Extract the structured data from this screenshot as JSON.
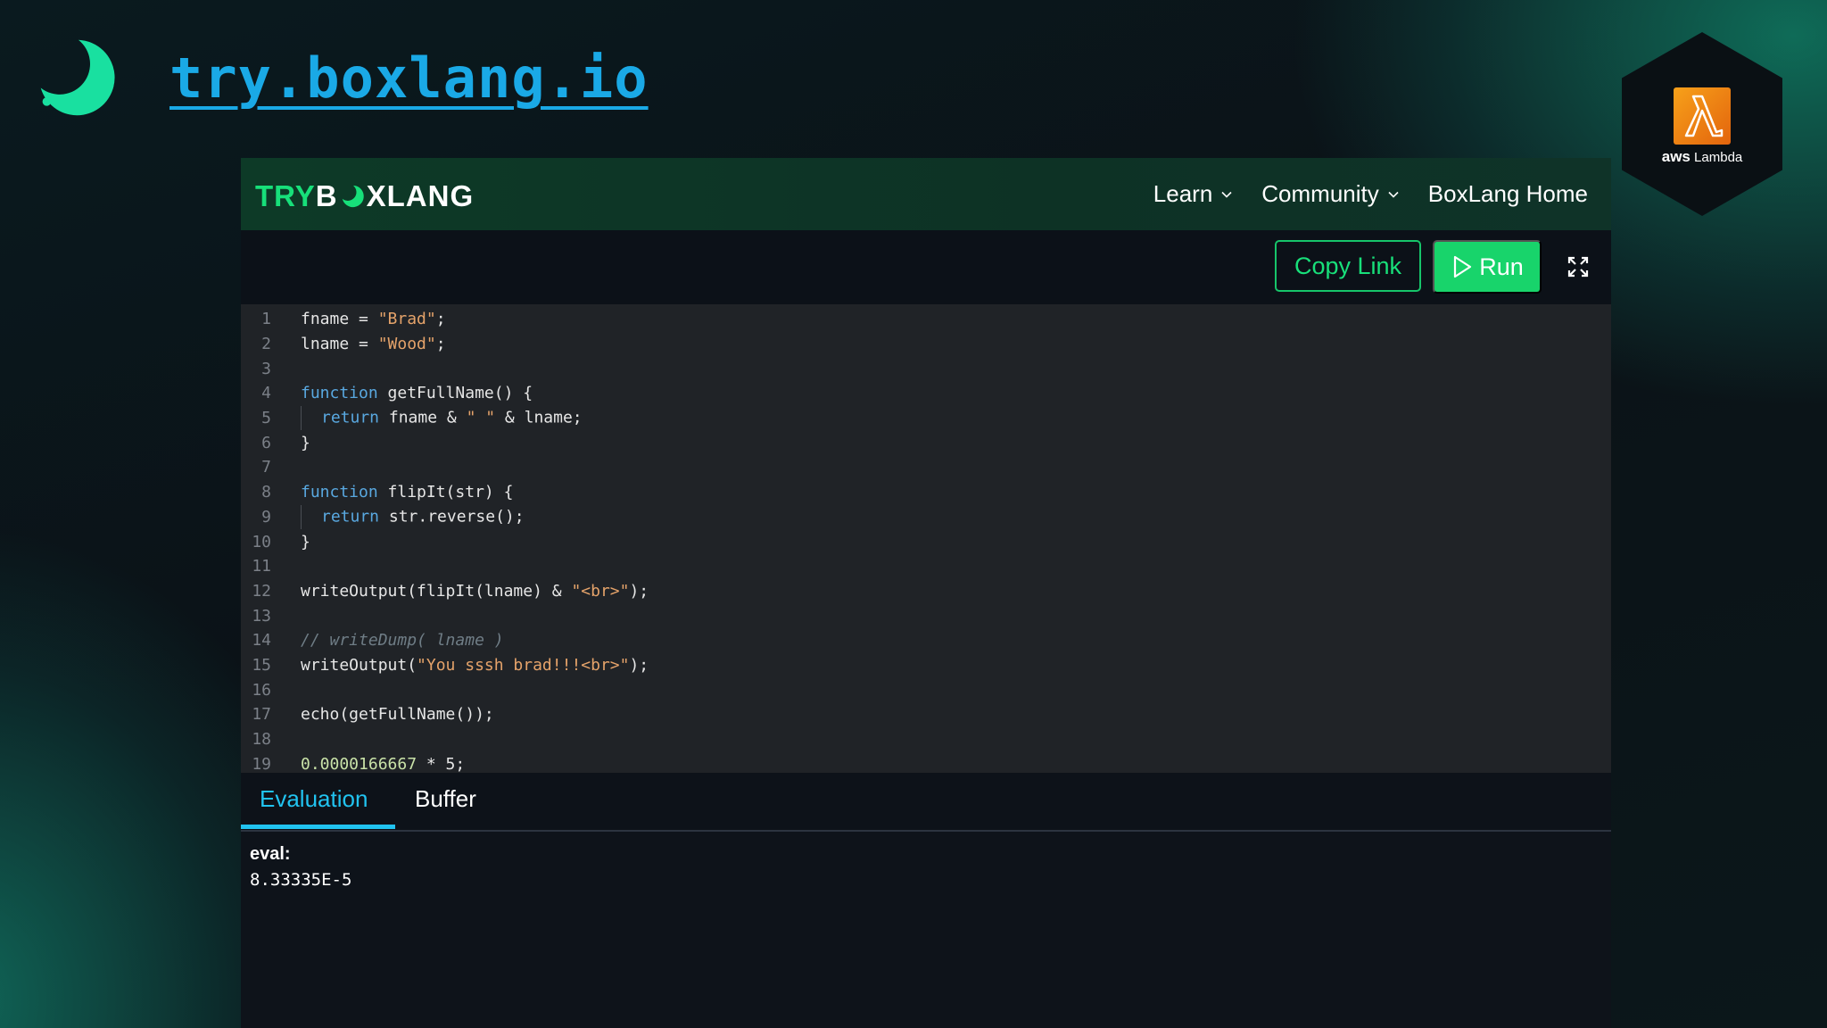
{
  "brand": {
    "url": "try.boxlang.io"
  },
  "aws_badge": {
    "aws": "aws",
    "service": "Lambda"
  },
  "app": {
    "logo": {
      "try": "TRY",
      "b": "B",
      "rest": "XLANG"
    },
    "nav": [
      {
        "label": "Learn",
        "has_dropdown": true
      },
      {
        "label": "Community",
        "has_dropdown": true
      },
      {
        "label": "BoxLang Home",
        "has_dropdown": false
      }
    ],
    "toolbar": {
      "copy_link": "Copy Link",
      "run": "Run"
    },
    "tabs": [
      {
        "label": "Evaluation",
        "active": true
      },
      {
        "label": "Buffer",
        "active": false
      }
    ],
    "output": {
      "label": "eval:",
      "value": "8.33335E-5"
    }
  },
  "code": {
    "lines": [
      {
        "n": "1",
        "tokens": [
          {
            "t": "fname = ",
            "c": "code"
          },
          {
            "t": "\"Brad\"",
            "c": "str"
          },
          {
            "t": ";",
            "c": "code"
          }
        ]
      },
      {
        "n": "2",
        "tokens": [
          {
            "t": "lname = ",
            "c": "code"
          },
          {
            "t": "\"Wood\"",
            "c": "str"
          },
          {
            "t": ";",
            "c": "code"
          }
        ]
      },
      {
        "n": "3",
        "tokens": []
      },
      {
        "n": "4",
        "tokens": [
          {
            "t": "function",
            "c": "kw"
          },
          {
            "t": " getFullName() {",
            "c": "code"
          }
        ]
      },
      {
        "n": "5",
        "indent": true,
        "tokens": [
          {
            "t": "return",
            "c": "kw"
          },
          {
            "t": " fname & ",
            "c": "code"
          },
          {
            "t": "\" \"",
            "c": "str"
          },
          {
            "t": " & lname;",
            "c": "code"
          }
        ]
      },
      {
        "n": "6",
        "tokens": [
          {
            "t": "}",
            "c": "code"
          }
        ]
      },
      {
        "n": "7",
        "tokens": []
      },
      {
        "n": "8",
        "tokens": [
          {
            "t": "function",
            "c": "kw"
          },
          {
            "t": " flipIt(str) {",
            "c": "code"
          }
        ]
      },
      {
        "n": "9",
        "indent": true,
        "tokens": [
          {
            "t": "return",
            "c": "kw"
          },
          {
            "t": " str.reverse();",
            "c": "code"
          }
        ]
      },
      {
        "n": "10",
        "tokens": [
          {
            "t": "}",
            "c": "code"
          }
        ]
      },
      {
        "n": "11",
        "tokens": []
      },
      {
        "n": "12",
        "tokens": [
          {
            "t": "writeOutput(flipIt(lname) & ",
            "c": "code"
          },
          {
            "t": "\"<br>\"",
            "c": "str"
          },
          {
            "t": ");",
            "c": "code"
          }
        ]
      },
      {
        "n": "13",
        "tokens": []
      },
      {
        "n": "14",
        "tokens": [
          {
            "t": "// writeDump( lname )",
            "c": "cm"
          }
        ]
      },
      {
        "n": "15",
        "tokens": [
          {
            "t": "writeOutput(",
            "c": "code"
          },
          {
            "t": "\"You sssh brad!!!<br>\"",
            "c": "str"
          },
          {
            "t": ");",
            "c": "code"
          }
        ]
      },
      {
        "n": "16",
        "tokens": []
      },
      {
        "n": "17",
        "tokens": [
          {
            "t": "echo(getFullName());",
            "c": "code"
          }
        ]
      },
      {
        "n": "18",
        "tokens": []
      },
      {
        "n": "19",
        "tokens": [
          {
            "t": "0.0000166667",
            "c": "num"
          },
          {
            "t": " * 5;",
            "c": "code"
          }
        ]
      }
    ]
  }
}
